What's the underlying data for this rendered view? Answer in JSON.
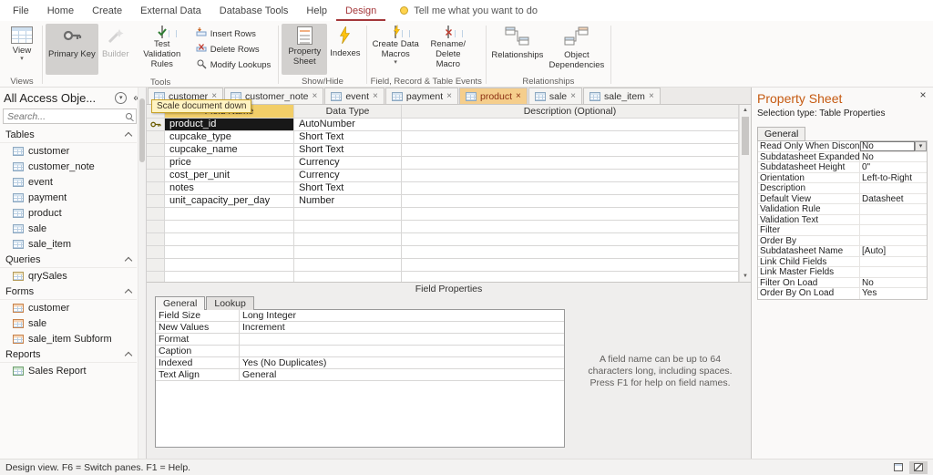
{
  "colors": {
    "accent": "#A4373A",
    "property_sheet_title": "#C55A11",
    "active_doc_tab_bg": "#F5CE8C",
    "field_name_header_highlight": "#F2CE68",
    "selected_cell_bg": "#181818"
  },
  "menubar": {
    "items": [
      "File",
      "Home",
      "Create",
      "External Data",
      "Database Tools",
      "Help",
      "Design"
    ],
    "active_item": "Design",
    "tell_me": "Tell me what you want to do"
  },
  "ribbon": {
    "groups": [
      "Views",
      "Tools",
      "Show/Hide",
      "Field, Record & Table Events",
      "Relationships"
    ],
    "view": "View",
    "primary_key": "Primary Key",
    "builder": "Builder",
    "test_validation_rules": "Test Validation Rules",
    "insert_rows": "Insert Rows",
    "delete_rows": "Delete Rows",
    "modify_lookups": "Modify Lookups",
    "property_sheet": "Property Sheet",
    "indexes": "Indexes",
    "create_data_macros_line1": "Create Data",
    "create_data_macros_line2": "Macros",
    "rename_delete_macro_line1": "Rename/",
    "rename_delete_macro_line2": "Delete Macro",
    "relationships": "Relationships",
    "object_dependencies": "Object Dependencies"
  },
  "nav": {
    "title": "All Access Obje...",
    "search_placeholder": "Search...",
    "sections": [
      {
        "label": "Tables",
        "items": [
          "customer",
          "customer_note",
          "event",
          "payment",
          "product",
          "sale",
          "sale_item"
        ]
      },
      {
        "label": "Queries",
        "items": [
          "qrySales"
        ]
      },
      {
        "label": "Forms",
        "items": [
          "customer",
          "sale",
          "sale_item Subform"
        ]
      },
      {
        "label": "Reports",
        "items": [
          "Sales Report"
        ]
      }
    ]
  },
  "doc_tabs": {
    "tabs": [
      "customer",
      "customer_note",
      "event",
      "payment",
      "product",
      "sale",
      "sale_item"
    ],
    "active": "product"
  },
  "tooltip": {
    "text": "Scale document down"
  },
  "design_grid": {
    "headers": [
      "Field Name",
      "Data Type",
      "Description (Optional)"
    ],
    "rows": [
      {
        "field": "product_id",
        "type": "AutoNumber",
        "primary_key": true,
        "selected": true
      },
      {
        "field": "cupcake_type",
        "type": "Short Text"
      },
      {
        "field": "cupcake_name",
        "type": "Short Text"
      },
      {
        "field": "price",
        "type": "Currency"
      },
      {
        "field": "cost_per_unit",
        "type": "Currency"
      },
      {
        "field": "notes",
        "type": "Short Text"
      },
      {
        "field": "unit_capacity_per_day",
        "type": "Number"
      }
    ]
  },
  "field_properties": {
    "caption": "Field Properties",
    "tabs": [
      "General",
      "Lookup"
    ],
    "active_tab": "General",
    "rows": [
      {
        "label": "Field Size",
        "value": "Long Integer"
      },
      {
        "label": "New Values",
        "value": "Increment"
      },
      {
        "label": "Format",
        "value": ""
      },
      {
        "label": "Caption",
        "value": ""
      },
      {
        "label": "Indexed",
        "value": "Yes (No Duplicates)"
      },
      {
        "label": "Text Align",
        "value": "General"
      }
    ],
    "help_text": "A field name can be up to 64 characters long, including spaces. Press F1 for help on field names."
  },
  "property_sheet": {
    "title": "Property Sheet",
    "selection_type": "Selection type: Table Properties",
    "tab": "General",
    "rows": [
      {
        "label": "Read Only When Disconnect",
        "value": "No",
        "selected": true
      },
      {
        "label": "Subdatasheet Expanded",
        "value": "No"
      },
      {
        "label": "Subdatasheet Height",
        "value": "0\""
      },
      {
        "label": "Orientation",
        "value": "Left-to-Right"
      },
      {
        "label": "Description",
        "value": ""
      },
      {
        "label": "Default View",
        "value": "Datasheet"
      },
      {
        "label": "Validation Rule",
        "value": ""
      },
      {
        "label": "Validation Text",
        "value": ""
      },
      {
        "label": "Filter",
        "value": ""
      },
      {
        "label": "Order By",
        "value": ""
      },
      {
        "label": "Subdatasheet Name",
        "value": "[Auto]"
      },
      {
        "label": "Link Child Fields",
        "value": ""
      },
      {
        "label": "Link Master Fields",
        "value": ""
      },
      {
        "label": "Filter On Load",
        "value": "No"
      },
      {
        "label": "Order By On Load",
        "value": "Yes"
      }
    ]
  },
  "statusbar": {
    "message": "Design view.  F6 = Switch panes.  F1 = Help."
  }
}
